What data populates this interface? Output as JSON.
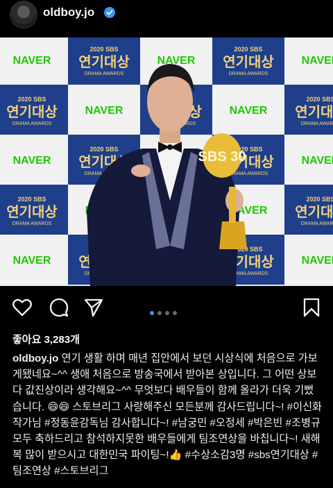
{
  "header": {
    "username": "oldboy.jo",
    "verified_icon": "verified-badge-icon"
  },
  "photo": {
    "backdrop_texts": {
      "naver": "NAVER",
      "sbs_year": "2020 SBS",
      "sbs_title": "연기대상",
      "sbs_sub": "DRAMA AWARDS"
    },
    "trophy_text": "SBS 30"
  },
  "actions": {
    "like_icon": "heart-icon",
    "comment_icon": "comment-icon",
    "share_icon": "paper-plane-icon",
    "save_icon": "bookmark-icon",
    "carousel_count": 4,
    "carousel_active": 1
  },
  "likes": {
    "text": "좋아요 3,283개"
  },
  "caption": {
    "username": "oldboy.jo",
    "body": " 연기 생활 하며 매년 집안에서 보던 시상식에 처음으로 가보게됐네요~^^ 생애 처음으로 방송국에서 받아본 상입니다. 그 어떤 상보다 값진상이라 생각해요~^^ 무엇보다 배우들이 함께 올라가 더욱 기뻤습니다. 😄😄 스토브리그 사랑해주신 모든분께 감사드립니다~! #이신화작가님 #정동윤감독님 감사합니다~! #남궁민 #오정세 #박은빈 #조병규 모두 축하드리고 참석하지못한 배우들에게 팀조연상을 바칩니다~! 새해 복 많이 받으시고 대한민국 파이팅~!👍 #수상소감3명 #sbs연기대상 #팀조연상 #스토브리그"
  },
  "colors": {
    "background": "#000000",
    "accent_blue": "#3897f0",
    "naver_green": "#1ec800",
    "backdrop_blue": "#1f3f8a"
  }
}
